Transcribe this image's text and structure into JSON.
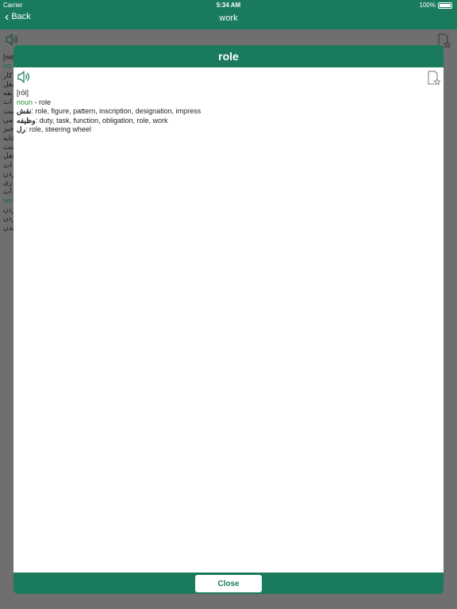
{
  "status": {
    "carrier": "Carrier",
    "time": "5:34 AM",
    "battery": "100%"
  },
  "nav": {
    "back_label": "Back",
    "title": "work"
  },
  "background": {
    "lines": [
      {
        "text": "[we",
        "class": ""
      },
      {
        "text": "no",
        "class": "g"
      },
      {
        "text": "کار",
        "class": ""
      },
      {
        "text": "شغل",
        "class": ""
      },
      {
        "text": "یفه",
        "class": ""
      },
      {
        "text": "ات",
        "class": ""
      },
      {
        "text": "ست",
        "class": ""
      },
      {
        "text": "می",
        "class": ""
      },
      {
        "text": "جیز",
        "class": ""
      },
      {
        "text": "خانه",
        "class": ""
      },
      {
        "text": "ست",
        "class": ""
      },
      {
        "text": "فعل",
        "class": ""
      },
      {
        "text": "ات",
        "class": ""
      },
      {
        "text": "ردن",
        "class": ""
      },
      {
        "text": "ری",
        "class": ""
      },
      {
        "text": "ات",
        "class": ""
      },
      {
        "text": "ver",
        "class": "g"
      },
      {
        "text": "ردن",
        "class": ""
      },
      {
        "text": "ردن",
        "class": ""
      },
      {
        "text": "یدن",
        "class": ""
      }
    ]
  },
  "modal": {
    "title": "role",
    "pronunciation": "[rōl]",
    "pos": "noun",
    "pos_rest": " - role",
    "senses": [
      {
        "fa": "نقش",
        "en": ": role, figure, pattern, inscription, designation, impress"
      },
      {
        "fa": "وظیفه",
        "en": ": duty, task, function, obligation, role, work"
      },
      {
        "fa": "رل",
        "en": ": role, steering wheel"
      }
    ],
    "close_label": "Close"
  }
}
